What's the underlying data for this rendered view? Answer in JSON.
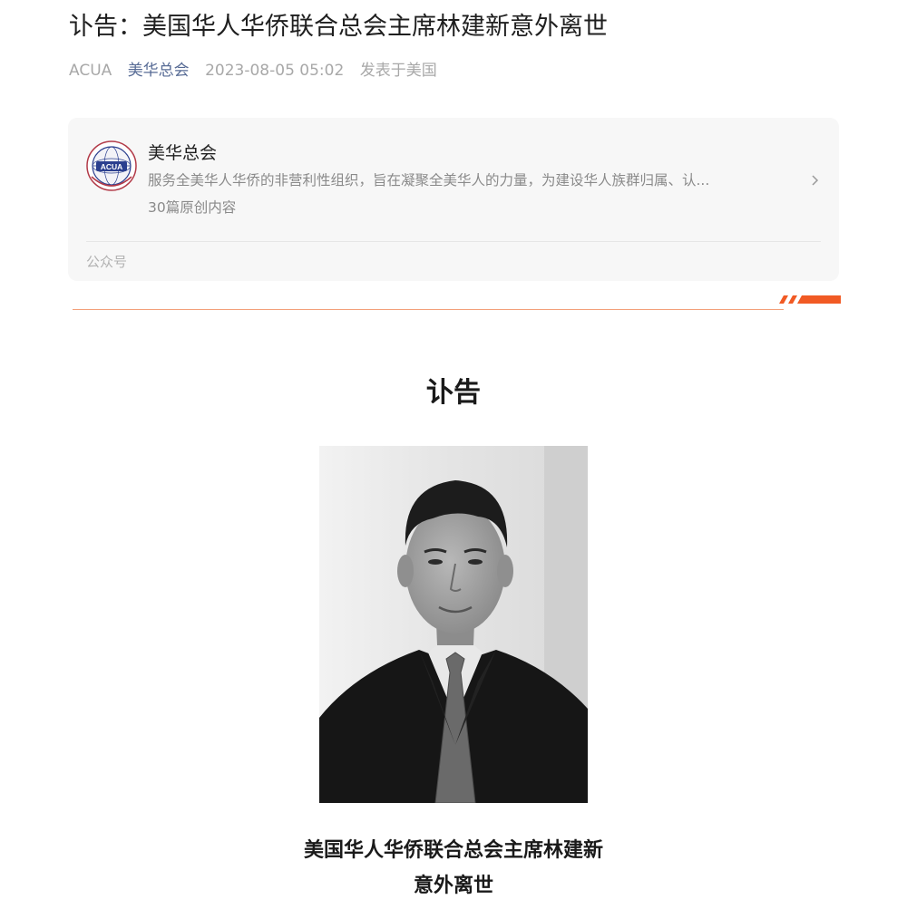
{
  "article": {
    "title": "讣告：美国华人华侨联合总会主席林建新意外离世",
    "author": "ACUA",
    "account_name": "美华总会",
    "datetime": "2023-08-05 05:02",
    "location": "发表于美国"
  },
  "profile_card": {
    "avatar_label": "ACUA",
    "name": "美华总会",
    "description": "服务全美华人华侨的非营利性组织，旨在凝聚全美华人的力量，为建设华人族群归属、认...",
    "article_count": "30篇原创内容",
    "type_label": "公众号",
    "icons": {
      "avatar": "acua-logo",
      "chevron": "chevron-right-icon"
    }
  },
  "body": {
    "heading": "讣告",
    "photo": "portrait-photo",
    "caption_line1": "美国华人华侨联合总会主席林建新",
    "caption_line2": "意外离世"
  },
  "colors": {
    "link": "#576b95",
    "accent": "#f15a24",
    "meta_gray": "#a8a8a8",
    "card_bg": "#f7f7f7"
  }
}
